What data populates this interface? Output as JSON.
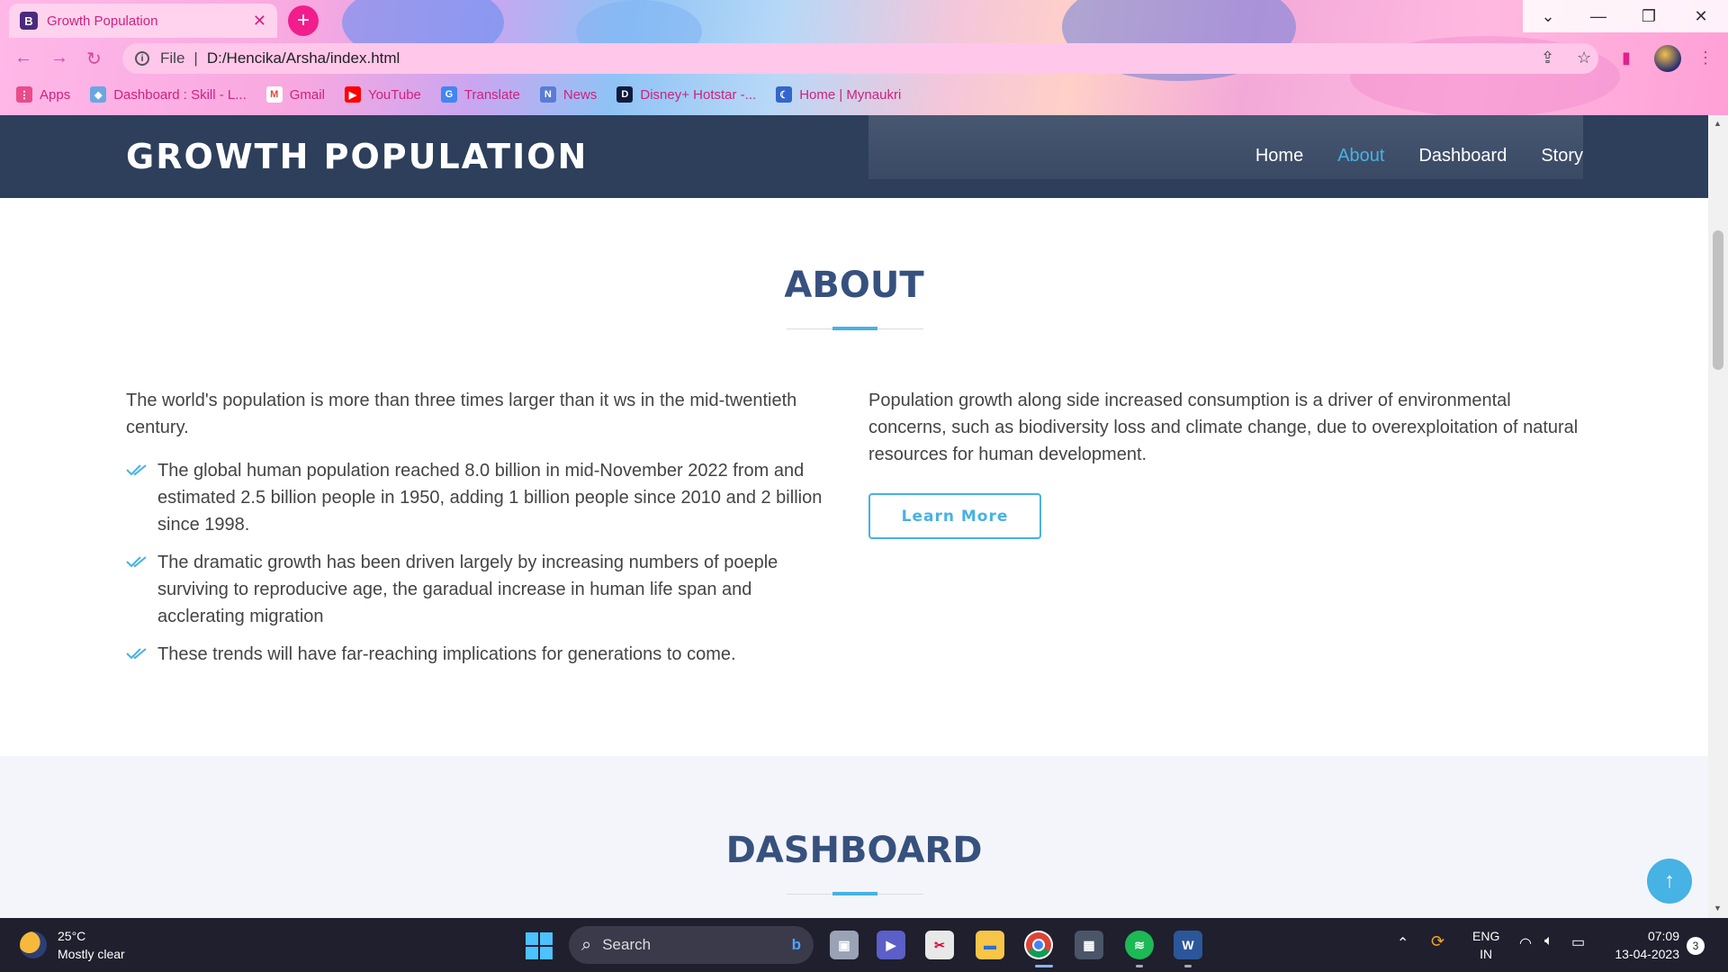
{
  "browser": {
    "tab_title": "Growth Population",
    "tab_favicon": "B",
    "address_scheme": "File",
    "address_url": "D:/Hencika/Arsha/index.html",
    "bookmarks": [
      {
        "label": "Apps",
        "icon": "apps-grid-icon",
        "color": "#e94b8b"
      },
      {
        "label": "Dashboard : Skill - L...",
        "icon": "skill-icon",
        "color": "#6aa7e0"
      },
      {
        "label": "Gmail",
        "icon": "gmail-icon",
        "color": "#ea4335"
      },
      {
        "label": "YouTube",
        "icon": "youtube-icon",
        "color": "#ff0000"
      },
      {
        "label": "Translate",
        "icon": "translate-icon",
        "color": "#4285f4"
      },
      {
        "label": "News",
        "icon": "news-icon",
        "color": "#5b7bd5"
      },
      {
        "label": "Disney+ Hotstar -...",
        "icon": "hotstar-icon",
        "color": "#0f1b3d"
      },
      {
        "label": "Home | Mynaukri",
        "icon": "mynaukri-icon",
        "color": "#3366cc"
      }
    ]
  },
  "site": {
    "logo": "GROWTH POPULATION",
    "nav": [
      "Home",
      "About",
      "Dashboard",
      "Story"
    ],
    "active_nav": "About"
  },
  "about": {
    "title": "ABOUT",
    "intro": "The world's population is more than three times larger than it ws in the mid-twentieth century.",
    "bullets": [
      "The global human population reached 8.0 billion in mid-November 2022 from and estimated 2.5 billion people in 1950, adding 1 billion people since 2010 and 2 billion since 1998.",
      "The dramatic growth has been driven largely by increasing numbers of poeple surviving to reproducive age, the garadual increase in human life span and acclerating migration",
      "These trends will have far-reaching implications for generations to come."
    ],
    "right_text": "Population growth along side increased consumption is a driver of environmental concerns, such as biodiversity loss and climate change, due to overexploitation of natural resources for human development.",
    "button": "Learn More"
  },
  "dashboard": {
    "title": "DASHBOARD"
  },
  "taskbar": {
    "temperature": "25°C",
    "weather": "Mostly clear",
    "search_label": "Search",
    "lang_top": "ENG",
    "lang_bottom": "IN",
    "time": "07:09",
    "date": "13-04-2023",
    "notification_count": "3"
  },
  "colors": {
    "accent": "#47b2e4",
    "header_bg": "#2d3f5b",
    "title": "#37517e"
  }
}
